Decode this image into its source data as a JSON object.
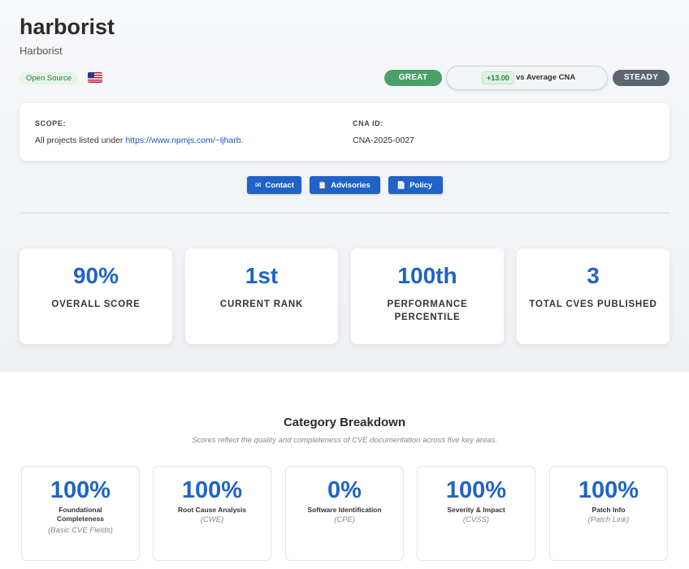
{
  "header": {
    "title": "harborist",
    "subtitle": "Harborist",
    "tag": "Open Source",
    "flag_icon": "us-flag-icon"
  },
  "status": {
    "great": "GREAT",
    "delta": "+13.00",
    "vs_label": "vs Average CNA",
    "steady": "STEADY"
  },
  "info": {
    "scope_label": "SCOPE:",
    "scope_text": "All projects listed under ",
    "scope_link": "https://www.npmjs.com/~ljharb",
    "scope_end": ".",
    "cna_label": "CNA ID:",
    "cna_value": "CNA-2025-0027"
  },
  "buttons": {
    "contact": "Contact",
    "contact_icon": "mail-icon",
    "advisories": "Advisories",
    "advisories_icon": "clipboard-icon",
    "policy": "Policy",
    "policy_icon": "document-icon"
  },
  "stats": [
    {
      "value": "90%",
      "label": "OVERALL SCORE"
    },
    {
      "value": "1st",
      "label": "CURRENT RANK"
    },
    {
      "value": "100th",
      "label": "PERFORMANCE PERCENTILE"
    },
    {
      "value": "3",
      "label": "TOTAL CVES PUBLISHED"
    }
  ],
  "breakdown": {
    "title": "Category Breakdown",
    "subtitle": "Scores reflect the quality and completeness of CVE documentation across five key areas.",
    "categories": [
      {
        "pct": "100%",
        "name": "Foundational Completeness",
        "sub": "(Basic CVE Fields)"
      },
      {
        "pct": "100%",
        "name": "Root Cause Analysis",
        "sub": "(CWE)"
      },
      {
        "pct": "0%",
        "name": "Software Identification",
        "sub": "(CPE)"
      },
      {
        "pct": "100%",
        "name": "Severity & Impact",
        "sub": "(CVSS)"
      },
      {
        "pct": "100%",
        "name": "Patch Info",
        "sub": "(Patch Link)"
      }
    ]
  },
  "colors": {
    "accent": "#1f63c9",
    "great": "#49a06a",
    "steady": "#5c6672"
  }
}
